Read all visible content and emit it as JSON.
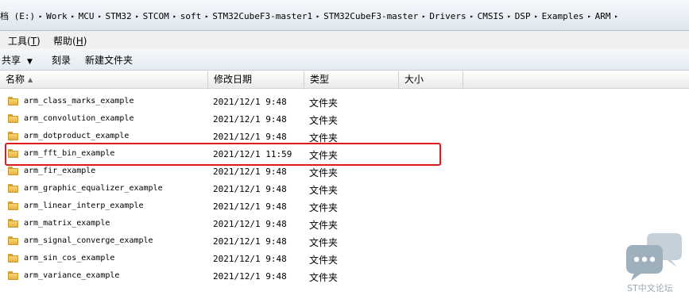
{
  "address_bar": {
    "crumbs": [
      "档 (E:)",
      "Work",
      "MCU",
      "STM32",
      "STCOM",
      "soft",
      "STM32CubeF3-master1",
      "STM32CubeF3-master",
      "Drivers",
      "CMSIS",
      "DSP",
      "Examples",
      "ARM"
    ],
    "separator_icon": "chevron-right-icon"
  },
  "menu": {
    "tools": {
      "label": "工具",
      "key": "T"
    },
    "help": {
      "label": "帮助",
      "key": "H"
    }
  },
  "toolbar": {
    "share": "共享",
    "burn": "刻录",
    "new_folder": "新建文件夹"
  },
  "columns": {
    "name": "名称",
    "modified": "修改日期",
    "type": "类型",
    "size": "大小"
  },
  "files": [
    {
      "name": "arm_class_marks_example",
      "modified": "2021/12/1 9:48",
      "type": "文件夹"
    },
    {
      "name": "arm_convolution_example",
      "modified": "2021/12/1 9:48",
      "type": "文件夹"
    },
    {
      "name": "arm_dotproduct_example",
      "modified": "2021/12/1 9:48",
      "type": "文件夹"
    },
    {
      "name": "arm_fft_bin_example",
      "modified": "2021/12/1 11:59",
      "type": "文件夹"
    },
    {
      "name": "arm_fir_example",
      "modified": "2021/12/1 9:48",
      "type": "文件夹"
    },
    {
      "name": "arm_graphic_equalizer_example",
      "modified": "2021/12/1 9:48",
      "type": "文件夹"
    },
    {
      "name": "arm_linear_interp_example",
      "modified": "2021/12/1 9:48",
      "type": "文件夹"
    },
    {
      "name": "arm_matrix_example",
      "modified": "2021/12/1 9:48",
      "type": "文件夹"
    },
    {
      "name": "arm_signal_converge_example",
      "modified": "2021/12/1 9:48",
      "type": "文件夹"
    },
    {
      "name": "arm_sin_cos_example",
      "modified": "2021/12/1 9:48",
      "type": "文件夹"
    },
    {
      "name": "arm_variance_example",
      "modified": "2021/12/1 9:48",
      "type": "文件夹"
    }
  ],
  "highlighted_row": "arm_fft_bin_example",
  "highlight_color": "#e0191b",
  "watermark": {
    "text": "ST中文论坛",
    "icon": "chat-bubbles-icon"
  }
}
